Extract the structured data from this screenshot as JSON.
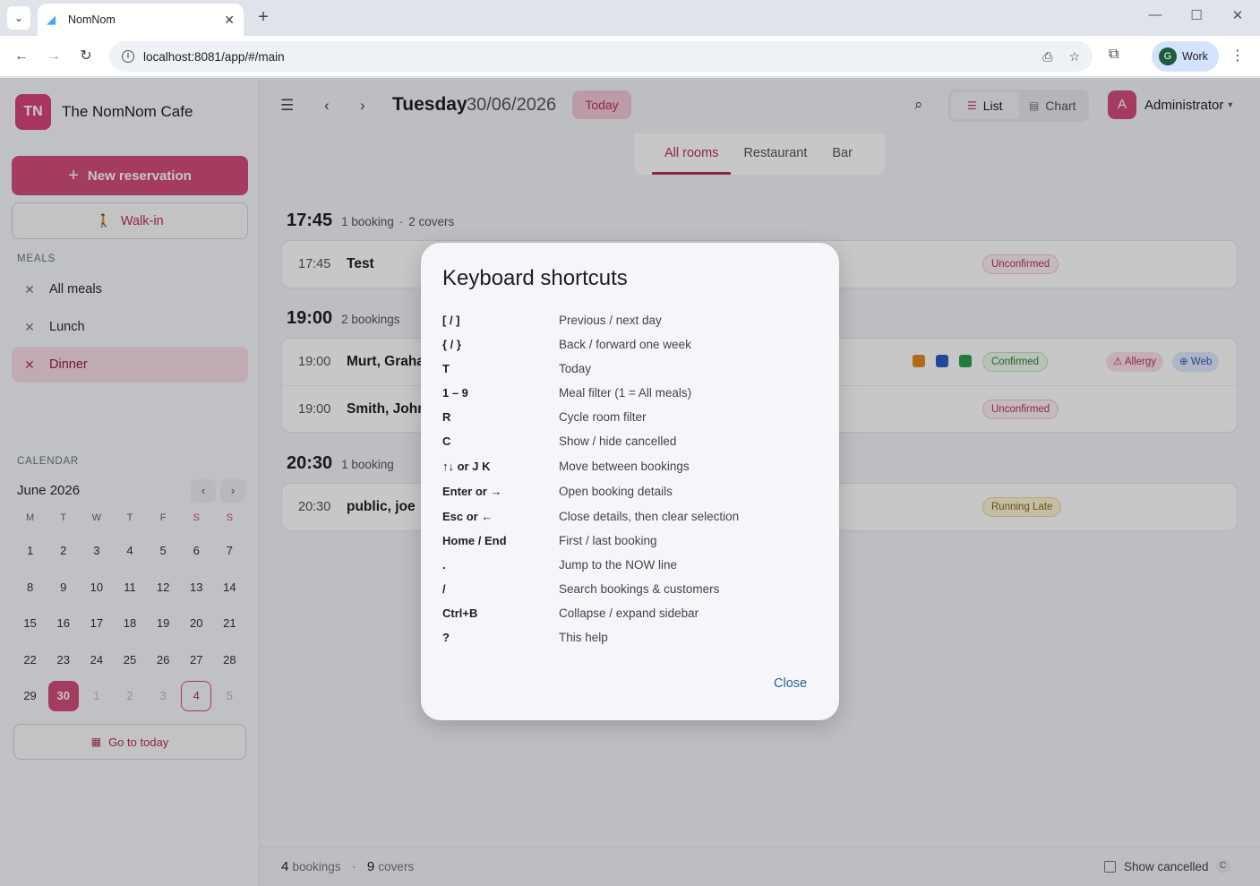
{
  "browser": {
    "tab_title": "NomNom",
    "url": "localhost:8081/app/#/main",
    "profile_initial": "G",
    "profile_label": "Work"
  },
  "sidebar": {
    "brand_initials": "TN",
    "brand_name": "The NomNom Cafe",
    "new_reservation": "New reservation",
    "walk_in": "Walk-in",
    "meals_label": "MEALS",
    "meals": [
      {
        "label": "All meals"
      },
      {
        "label": "Lunch"
      },
      {
        "label": "Dinner"
      }
    ],
    "calendar_label": "CALENDAR",
    "calendar": {
      "month": "June 2026",
      "weekdays": [
        "M",
        "T",
        "W",
        "T",
        "F",
        "S",
        "S"
      ],
      "weeks": [
        [
          "1",
          "2",
          "3",
          "4",
          "5",
          "6",
          "7"
        ],
        [
          "8",
          "9",
          "10",
          "11",
          "12",
          "13",
          "14"
        ],
        [
          "15",
          "16",
          "17",
          "18",
          "19",
          "20",
          "21"
        ],
        [
          "22",
          "23",
          "24",
          "25",
          "26",
          "27",
          "28"
        ],
        [
          "29",
          "30",
          "1",
          "2",
          "3",
          "4",
          "5"
        ]
      ]
    },
    "go_to_today": "Go to today"
  },
  "topbar": {
    "day_name": "Tuesday",
    "date": "30/06/2026",
    "today": "Today",
    "view_list": "List",
    "view_chart": "Chart",
    "user_initial": "A",
    "user_name": "Administrator"
  },
  "rooms": [
    "All rooms",
    "Restaurant",
    "Bar"
  ],
  "slots": [
    {
      "time": "17:45",
      "bookings": "1 booking",
      "covers": "2 covers",
      "rows": [
        {
          "time": "17:45",
          "name": "Test",
          "status": "Unconfirmed"
        }
      ]
    },
    {
      "time": "19:00",
      "bookings": "2 bookings",
      "covers": "",
      "rows": [
        {
          "time": "19:00",
          "name": "Murt, Graha",
          "status": "Confirmed",
          "allergy": "Allergy",
          "web": "Web"
        },
        {
          "time": "19:00",
          "name": "Smith, John",
          "status": "Unconfirmed"
        }
      ]
    },
    {
      "time": "20:30",
      "bookings": "1 booking",
      "covers": "",
      "rows": [
        {
          "time": "20:30",
          "name": "public, joe",
          "status": "Running Late"
        }
      ]
    }
  ],
  "footer": {
    "bookings_count": "4",
    "bookings_label": "bookings",
    "covers_count": "9",
    "covers_label": "covers",
    "show_cancelled": "Show cancelled",
    "show_cancelled_key": "C"
  },
  "dialog": {
    "title": "Keyboard shortcuts",
    "shortcuts": [
      {
        "key": "[ / ]",
        "desc": "Previous / next day"
      },
      {
        "key": "{ / }",
        "desc": "Back / forward one week"
      },
      {
        "key": "T",
        "desc": "Today"
      },
      {
        "key": "1 – 9",
        "desc": "Meal filter (1 = All meals)"
      },
      {
        "key": "R",
        "desc": "Cycle room filter"
      },
      {
        "key": "C",
        "desc": "Show / hide cancelled"
      },
      {
        "key": "↑↓ or J K",
        "desc": "Move between bookings"
      },
      {
        "key": "Enter or →",
        "desc": "Open booking details"
      },
      {
        "key": "Esc or ←",
        "desc": "Close details, then clear selection"
      },
      {
        "key": "Home / End",
        "desc": "First / last booking"
      },
      {
        "key": ".",
        "desc": "Jump to the NOW line"
      },
      {
        "key": "/",
        "desc": "Search bookings & customers"
      },
      {
        "key": "Ctrl+B",
        "desc": "Collapse / expand sidebar"
      },
      {
        "key": "?",
        "desc": "This help"
      }
    ],
    "close": "Close"
  }
}
